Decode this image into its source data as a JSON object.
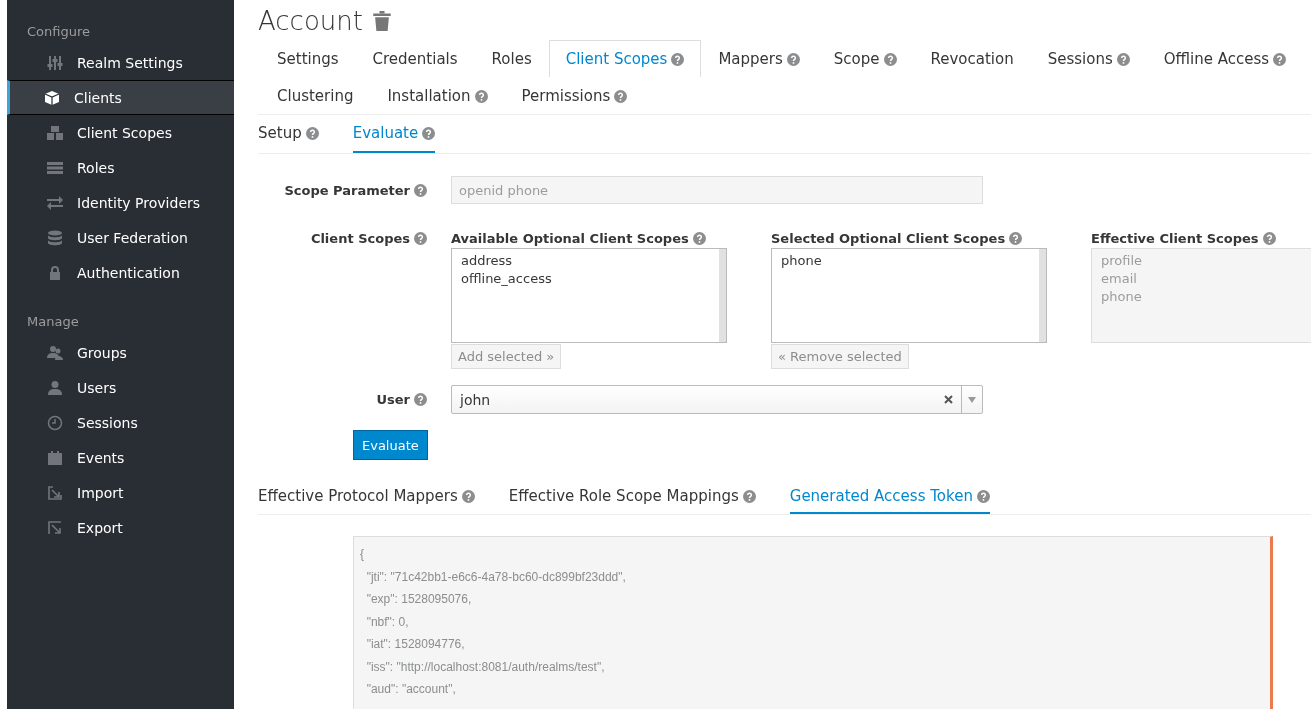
{
  "sidebar": {
    "sections": [
      {
        "heading": "Configure",
        "items": [
          {
            "label": "Realm Settings",
            "selected": false
          },
          {
            "label": "Clients",
            "selected": true
          },
          {
            "label": "Client Scopes",
            "selected": false
          },
          {
            "label": "Roles",
            "selected": false
          },
          {
            "label": "Identity Providers",
            "selected": false
          },
          {
            "label": "User Federation",
            "selected": false
          },
          {
            "label": "Authentication",
            "selected": false
          }
        ]
      },
      {
        "heading": "Manage",
        "items": [
          {
            "label": "Groups",
            "selected": false
          },
          {
            "label": "Users",
            "selected": false
          },
          {
            "label": "Sessions",
            "selected": false
          },
          {
            "label": "Events",
            "selected": false
          },
          {
            "label": "Import",
            "selected": false
          },
          {
            "label": "Export",
            "selected": false
          }
        ]
      }
    ]
  },
  "page_title": "Account",
  "tabs": [
    {
      "label": "Settings",
      "help": false,
      "selected": false
    },
    {
      "label": "Credentials",
      "help": false,
      "selected": false
    },
    {
      "label": "Roles",
      "help": false,
      "selected": false
    },
    {
      "label": "Client Scopes",
      "help": true,
      "selected": true
    },
    {
      "label": "Mappers",
      "help": true,
      "selected": false
    },
    {
      "label": "Scope",
      "help": true,
      "selected": false
    },
    {
      "label": "Revocation",
      "help": false,
      "selected": false
    },
    {
      "label": "Sessions",
      "help": true,
      "selected": false
    },
    {
      "label": "Offline Access",
      "help": true,
      "selected": false
    },
    {
      "label": "Clustering",
      "help": false,
      "selected": false
    },
    {
      "label": "Installation",
      "help": true,
      "selected": false
    },
    {
      "label": "Permissions",
      "help": true,
      "selected": false
    }
  ],
  "subtabs": [
    {
      "label": "Setup",
      "selected": false
    },
    {
      "label": "Evaluate",
      "selected": true
    }
  ],
  "form": {
    "scope_parameter": {
      "label": "Scope Parameter",
      "value": "openid phone"
    },
    "client_scopes": {
      "label": "Client Scopes",
      "available": {
        "title": "Available Optional Client Scopes",
        "items": [
          "address",
          "offline_access"
        ],
        "button": "Add selected »"
      },
      "selected": {
        "title": "Selected Optional Client Scopes",
        "items": [
          "phone"
        ],
        "button": "« Remove selected"
      },
      "effective": {
        "title": "Effective Client Scopes",
        "items": [
          "profile",
          "email",
          "phone"
        ]
      }
    },
    "user": {
      "label": "User",
      "value": "john"
    },
    "evaluate_button": "Evaluate"
  },
  "result_tabs": [
    {
      "label": "Effective Protocol Mappers",
      "selected": false
    },
    {
      "label": "Effective Role Scope Mappings",
      "selected": false
    },
    {
      "label": "Generated Access Token",
      "selected": true
    }
  ],
  "token_lines": [
    "{",
    "  \"jti\": \"71c42bb1-e6c6-4a78-bc60-dc899bf23ddd\",",
    "  \"exp\": 1528095076,",
    "  \"nbf\": 0,",
    "  \"iat\": 1528094776,",
    "  \"iss\": \"http://localhost:8081/auth/realms/test\",",
    "  \"aud\": \"account\","
  ]
}
